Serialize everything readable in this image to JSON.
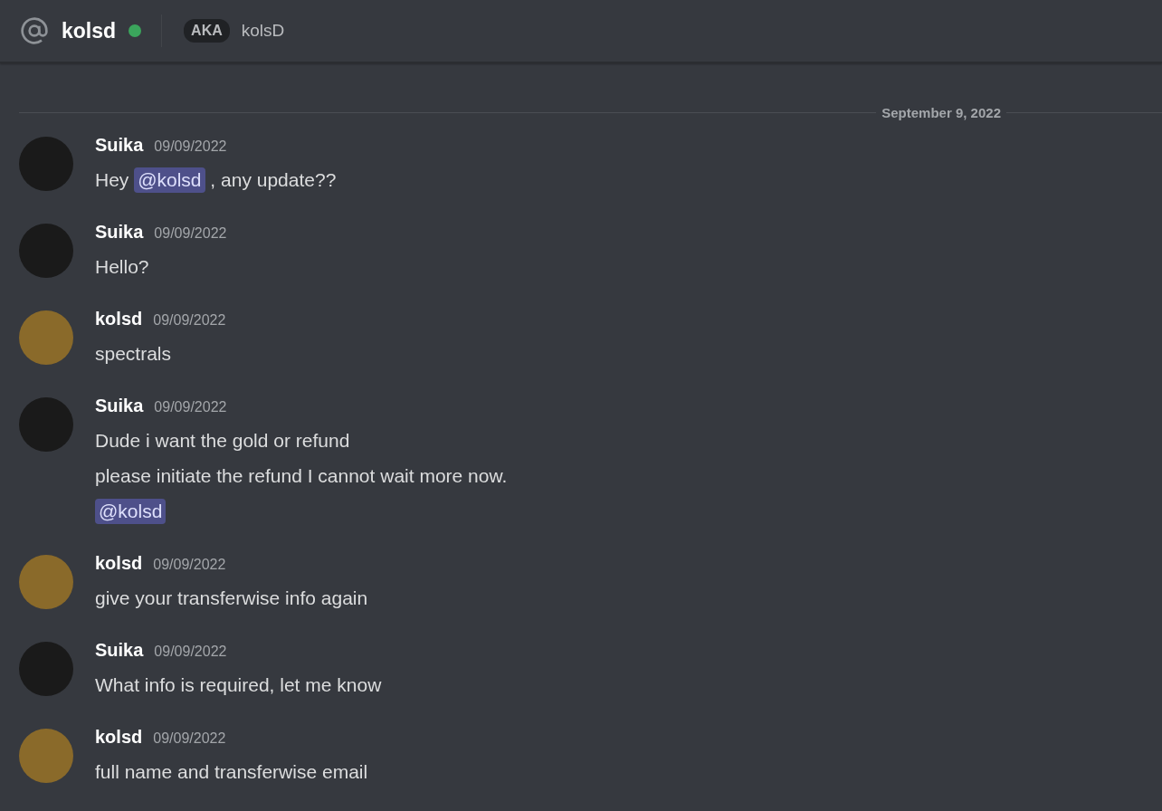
{
  "header": {
    "channel_name": "kolsd",
    "online": true,
    "aka_badge": "AKA",
    "aka_name": "kolsD"
  },
  "date_divider": "September 9, 2022",
  "messages": [
    {
      "author": "Suika",
      "timestamp": "09/09/2022",
      "avatar": {
        "color": "#1a1a1a"
      },
      "lines": [
        [
          {
            "kind": "text",
            "text": "Hey "
          },
          {
            "kind": "mention",
            "text": "@kolsd"
          },
          {
            "kind": "text",
            "text": " , any update??"
          }
        ]
      ]
    },
    {
      "author": "Suika",
      "timestamp": "09/09/2022",
      "avatar": {
        "color": "#1a1a1a"
      },
      "lines": [
        [
          {
            "kind": "text",
            "text": "Hello?"
          }
        ]
      ]
    },
    {
      "author": "kolsd",
      "timestamp": "09/09/2022",
      "avatar": {
        "color": "#8a6a2a"
      },
      "lines": [
        [
          {
            "kind": "text",
            "text": "spectrals"
          }
        ]
      ]
    },
    {
      "author": "Suika",
      "timestamp": "09/09/2022",
      "avatar": {
        "color": "#1a1a1a"
      },
      "lines": [
        [
          {
            "kind": "text",
            "text": "Dude i want the gold or refund"
          }
        ],
        [
          {
            "kind": "text",
            "text": "please initiate the refund I cannot wait more now."
          }
        ],
        [
          {
            "kind": "mention",
            "text": "@kolsd"
          }
        ]
      ]
    },
    {
      "author": "kolsd",
      "timestamp": "09/09/2022",
      "avatar": {
        "color": "#8a6a2a"
      },
      "lines": [
        [
          {
            "kind": "text",
            "text": "give your transferwise info again"
          }
        ]
      ]
    },
    {
      "author": "Suika",
      "timestamp": "09/09/2022",
      "avatar": {
        "color": "#1a1a1a"
      },
      "lines": [
        [
          {
            "kind": "text",
            "text": "What info is required, let me know"
          }
        ]
      ]
    },
    {
      "author": "kolsd",
      "timestamp": "09/09/2022",
      "avatar": {
        "color": "#8a6a2a"
      },
      "lines": [
        [
          {
            "kind": "text",
            "text": "full name and transferwise email"
          }
        ]
      ]
    }
  ]
}
